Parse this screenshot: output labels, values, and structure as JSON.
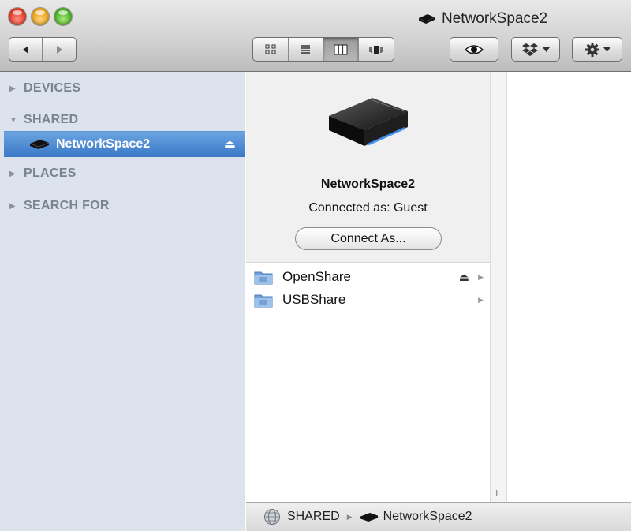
{
  "window": {
    "title": "NetworkSpace2"
  },
  "toolbar": {
    "back_icon": "back-arrow-icon",
    "forward_icon": "forward-arrow-icon",
    "view_modes": [
      "icon-view-icon",
      "list-view-icon",
      "column-view-icon",
      "cover-flow-icon"
    ],
    "active_view": "column-view-icon",
    "quicklook_icon": "eye-icon",
    "dropbox_icon": "dropbox-icon",
    "action_icon": "gear-icon"
  },
  "sidebar": {
    "groups": [
      {
        "label": "DEVICES",
        "expanded": false
      },
      {
        "label": "SHARED",
        "expanded": true
      },
      {
        "label": "PLACES",
        "expanded": false
      },
      {
        "label": "SEARCH FOR",
        "expanded": false
      }
    ],
    "shared_items": [
      {
        "label": "NetworkSpace2",
        "selected": true
      }
    ]
  },
  "preview": {
    "device_name": "NetworkSpace2",
    "connection_status": "Connected as: Guest",
    "connect_button_label": "Connect As..."
  },
  "shares": [
    {
      "name": "OpenShare",
      "mounted": true
    },
    {
      "name": "USBShare",
      "mounted": false
    }
  ],
  "pathbar": {
    "segments": [
      "SHARED",
      "NetworkSpace2"
    ]
  },
  "colors": {
    "selection": "#3b78c8",
    "sidebar_bg": "#dce3ec",
    "folder": "#6f9fd6"
  }
}
